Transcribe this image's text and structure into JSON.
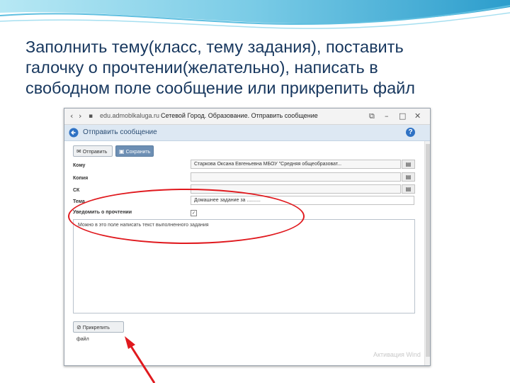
{
  "heading": {
    "line1": "Заполнить тему(класс, тему задания), поставить",
    "line2": "галочку о прочтении(желательно), написать в",
    "line3": "свободном поле сообщение или прикрепить файл"
  },
  "browser": {
    "url": "edu.admoblkaluga.ru",
    "page_title": "Сетевой Город. Образование. Отправить сообщение"
  },
  "window": {
    "title": "Отправить сообщение",
    "help": "?"
  },
  "toolbar": {
    "send_label": "Отправить",
    "save_label": "Сохранить"
  },
  "form": {
    "to_label": "Кому",
    "to_value": "Старкова Оксана Евгеньевна МБОУ \"Средняя общеобразоват...",
    "cc_label": "Копия",
    "cc_value": "",
    "bcc_label": "СК",
    "bcc_value": "",
    "subject_label": "Тема",
    "subject_value": "Домашнее задание за ..........",
    "notify_label": "Уведомить о прочтении",
    "notify_checked": true,
    "message": "Можно в это поле написать текст выполненного задания"
  },
  "attach_label": "Прикрепить файл",
  "watermark": "Активация Wind",
  "colors": {
    "heading": "#17375e",
    "highlight": "#e0191e",
    "title_bar": "#dde8f3",
    "save_button": "#6d8fb4"
  },
  "icons": [
    "back-arrow-icon",
    "help-icon",
    "envelope-icon",
    "floppy-disk-icon",
    "address-book-icon",
    "paperclip-icon",
    "checkmark-icon"
  ]
}
